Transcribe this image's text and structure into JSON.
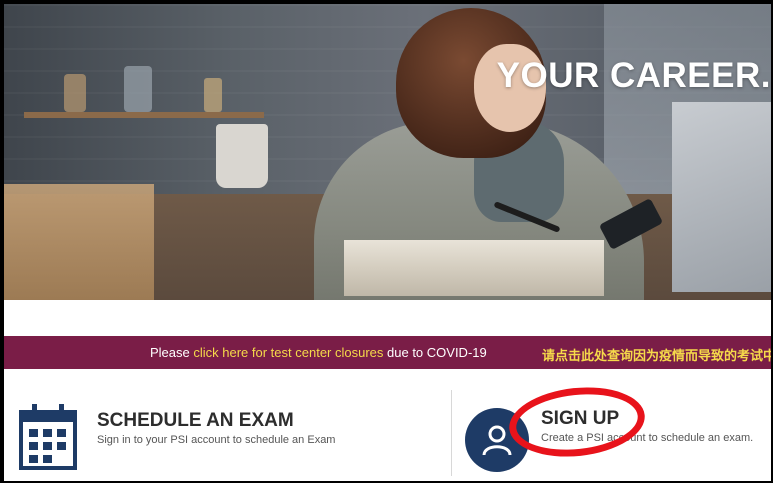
{
  "hero": {
    "title": "YOUR CAREER."
  },
  "banner": {
    "prefix": "Please ",
    "link_text": "click here for test center closures",
    "suffix": " due to COVID-19",
    "chinese_text": "请点击此处查询因为疫情而导致的考试中"
  },
  "cards": {
    "schedule": {
      "title": "SCHEDULE AN EXAM",
      "description": "Sign in to your PSI account to schedule an Exam",
      "icon": "calendar-icon"
    },
    "signup": {
      "title": "SIGN UP",
      "description": "Create a PSI account to schedule an exam.",
      "icon": "user-icon"
    }
  },
  "colors": {
    "banner_bg": "#7a1d47",
    "banner_link": "#f5d94a",
    "navy": "#1e3b66",
    "highlight": "#e8131b"
  }
}
